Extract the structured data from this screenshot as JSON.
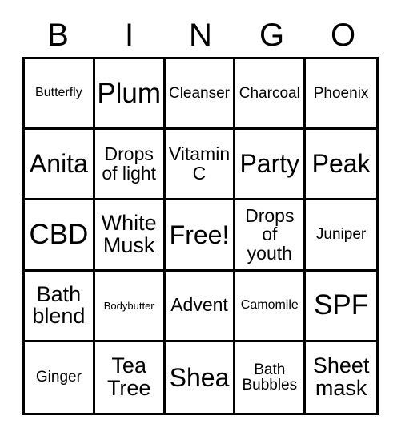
{
  "card": {
    "header_letters": [
      "B",
      "I",
      "N",
      "G",
      "O"
    ],
    "free_space_label": "Free!",
    "colors": {
      "border": "#000000",
      "background": "#ffffff",
      "text": "#000000"
    },
    "rows": [
      [
        {
          "label": "Butterfly",
          "size": "s-sm"
        },
        {
          "label": "Plum",
          "size": "s-xxxl"
        },
        {
          "label": "Cleanser",
          "size": "s-md"
        },
        {
          "label": "Charcoal",
          "size": "s-md"
        },
        {
          "label": "Phoenix",
          "size": "s-md"
        }
      ],
      [
        {
          "label": "Anita",
          "size": "s-xxl"
        },
        {
          "label": "Drops\nof light",
          "size": "s-lg"
        },
        {
          "label": "Vitamin\nC",
          "size": "s-lg"
        },
        {
          "label": "Party",
          "size": "s-xxl"
        },
        {
          "label": "Peak",
          "size": "s-xxl"
        }
      ],
      [
        {
          "label": "CBD",
          "size": "s-xxxl"
        },
        {
          "label": "White\nMusk",
          "size": "s-xl"
        },
        {
          "label": "Free!",
          "size": "s-xxl"
        },
        {
          "label": "Drops\nof\nyouth",
          "size": "s-lg"
        },
        {
          "label": "Juniper",
          "size": "s-md"
        }
      ],
      [
        {
          "label": "Bath\nblend",
          "size": "s-xl"
        },
        {
          "label": "Bodybutter",
          "size": "s-xs"
        },
        {
          "label": "Advent",
          "size": "s-lg"
        },
        {
          "label": "Camomile",
          "size": "s-sm"
        },
        {
          "label": "SPF",
          "size": "s-xxxl"
        }
      ],
      [
        {
          "label": "Ginger",
          "size": "s-md"
        },
        {
          "label": "Tea\nTree",
          "size": "s-xl"
        },
        {
          "label": "Shea",
          "size": "s-xxl"
        },
        {
          "label": "Bath\nBubbles",
          "size": "s-md"
        },
        {
          "label": "Sheet\nmask",
          "size": "s-xl"
        }
      ]
    ]
  }
}
